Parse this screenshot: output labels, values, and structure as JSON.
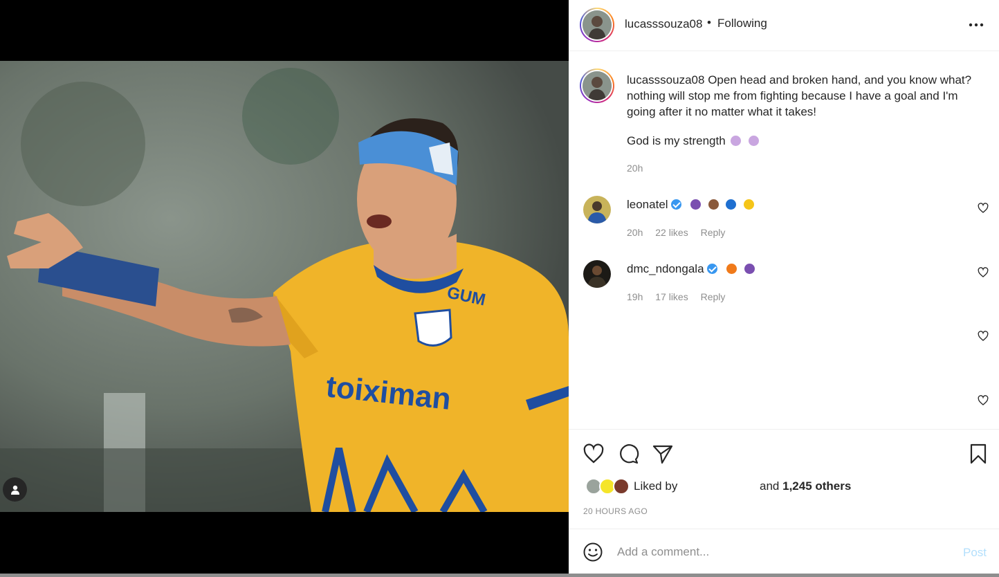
{
  "post": {
    "username": "lucasssouza08",
    "separator": "•",
    "follow_status": "Following",
    "more_icon": "more-dots-icon",
    "caption_text": "Open head and broken hand, and you know what? nothing will stop me from fighting because I have a goal and I'm going after it no matter what it takes!",
    "caption_line2": "God is my strength",
    "caption_time": "20h"
  },
  "comments": [
    {
      "username": "leonatel",
      "verified": true,
      "emojis": [
        "praying-hands",
        "flexed-biceps",
        "blue-heart",
        "yellow-heart"
      ],
      "time": "20h",
      "likes": "22 likes",
      "reply": "Reply"
    },
    {
      "username": "dmc_ndongala",
      "verified": true,
      "emojis": [
        "fire",
        "praying-hands"
      ],
      "time": "19h",
      "likes": "17 likes",
      "reply": "Reply"
    }
  ],
  "actions": {
    "like_icon": "heart-icon",
    "comment_icon": "comment-bubble-icon",
    "share_icon": "paper-plane-icon",
    "save_icon": "bookmark-icon"
  },
  "likes": {
    "liked_by_label": "Liked by",
    "and_label": "and",
    "others_count": "1,245 others"
  },
  "post_time": "20 HOURS AGO",
  "comment_box": {
    "placeholder": "Add a comment...",
    "post_label": "Post"
  },
  "colors": {
    "jersey_yellow": "#f0b429",
    "jersey_blue": "#1f4ea0",
    "headband_blue": "#4a8fd6",
    "post_button_disabled": "#b2dffc",
    "verified_blue": "#3897f0"
  }
}
